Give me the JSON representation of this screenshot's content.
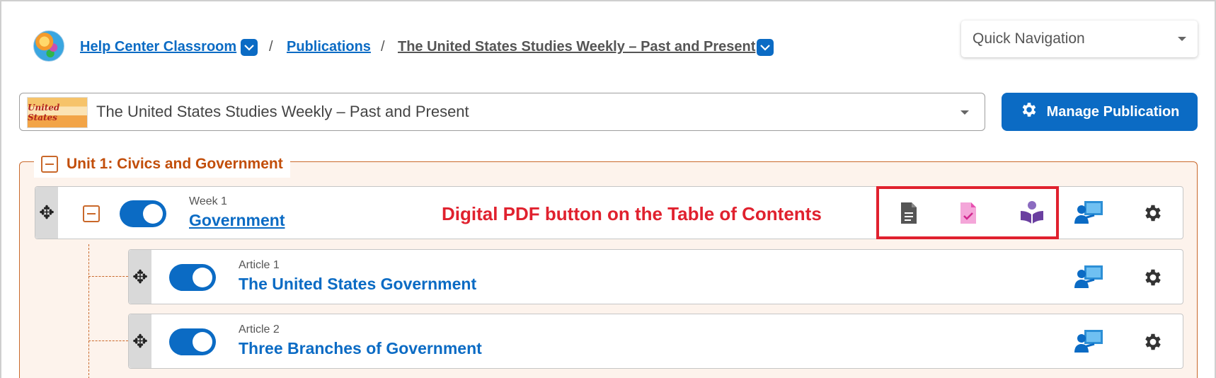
{
  "breadcrumb": {
    "items": [
      {
        "label": "Help Center Classroom"
      },
      {
        "label": "Publications"
      },
      {
        "label": "The United States Studies Weekly – Past and Present"
      }
    ],
    "separator": "/"
  },
  "quick_nav": {
    "label": "Quick Navigation"
  },
  "publication_select": {
    "value": "The United States Studies Weekly – Past and Present",
    "thumb_text": "United States"
  },
  "manage_button": {
    "label": "Manage Publication"
  },
  "unit": {
    "title": "Unit 1: Civics and Government"
  },
  "week": {
    "label": "Week 1",
    "title": "Government",
    "enabled": true
  },
  "articles": [
    {
      "label": "Article 1",
      "title": "The United States Government",
      "enabled": true
    },
    {
      "label": "Article 2",
      "title": "Three Branches of Government",
      "enabled": true
    }
  ],
  "annotation": {
    "text": "Digital PDF button on the Table of Contents"
  },
  "colors": {
    "primary": "#0b6bc4",
    "unit_accent": "#c24e0a",
    "annotation_red": "#e0212e",
    "pdf_icon": "#555555",
    "assignment_icon": "#e74fb0",
    "reader_icon": "#6a3fa0"
  },
  "icons": [
    "globe-icon",
    "chevron-down-icon",
    "gear-icon",
    "move-icon",
    "collapse-icon",
    "document-icon",
    "assignment-check-icon",
    "book-reader-icon",
    "teacher-present-icon"
  ]
}
